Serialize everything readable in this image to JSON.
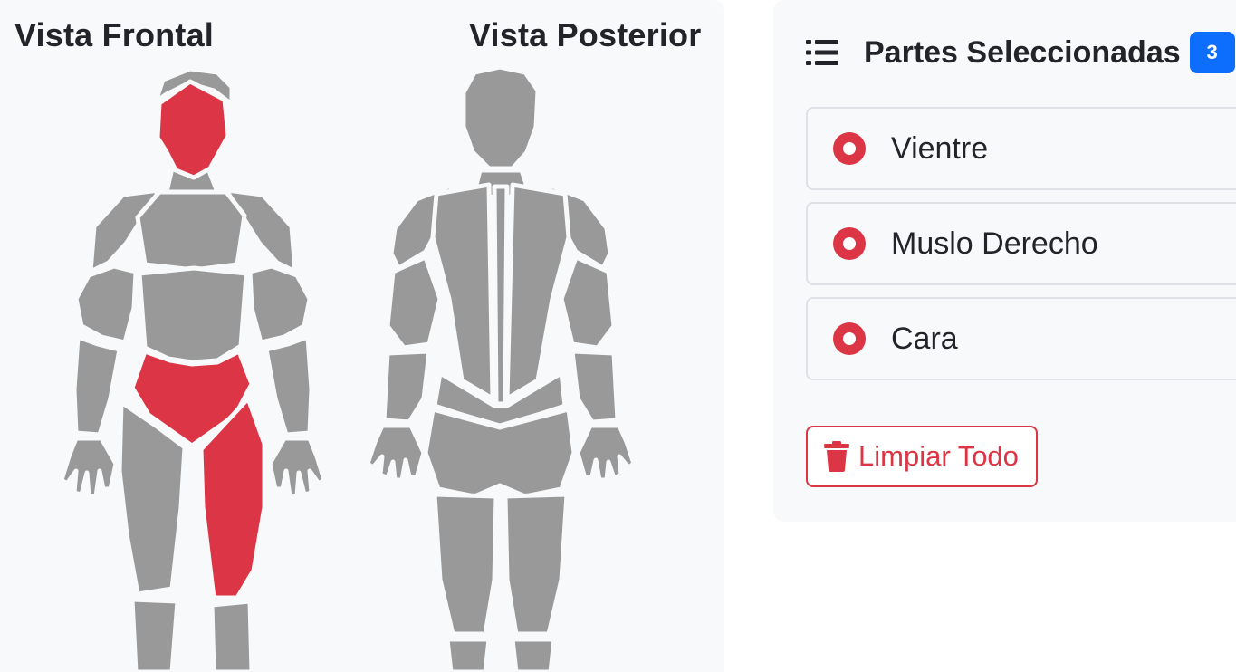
{
  "views": {
    "front_title": "Vista Frontal",
    "back_title": "Vista Posterior"
  },
  "colors": {
    "selected": "#dc3545",
    "unselected": "#999999",
    "badge": "#0d6efd"
  },
  "selection": {
    "title": "Partes Seleccionadas",
    "count": "3",
    "items": [
      {
        "label": "Vientre"
      },
      {
        "label": "Muslo Derecho"
      },
      {
        "label": "Cara"
      }
    ],
    "clear_label": "Limpiar Todo"
  },
  "icons": {
    "header": "list-icon",
    "item": "radio-dot-icon",
    "clear": "trash-icon"
  }
}
